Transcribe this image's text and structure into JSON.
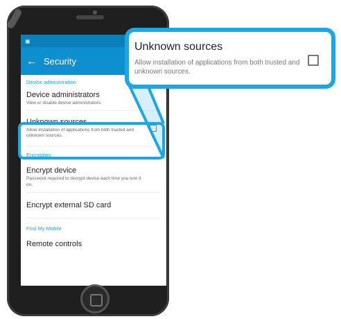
{
  "status_bar": {
    "left": "▣",
    "right": "▾ ▴ ◼"
  },
  "app_bar": {
    "back_icon": "←",
    "title": "Security"
  },
  "sections": {
    "device_admin": "Device administration",
    "encryption": "Encryption",
    "find_mobile": "Find My Mobile"
  },
  "items": {
    "device_admins": {
      "title": "Device administrators",
      "subtitle": "View or disable device administrators."
    },
    "unknown_sources": {
      "title": "Unknown sources",
      "subtitle": "Allow installation of applications from both trusted and unknown sources."
    },
    "encrypt_device": {
      "title": "Encrypt device",
      "subtitle": "Password required to decrypt device each time you turn it on."
    },
    "encrypt_sd": {
      "title": "Encrypt external SD card"
    },
    "remote_controls": {
      "title": "Remote controls"
    }
  },
  "callout": {
    "title": "Unknown sources",
    "subtitle": "Allow installation of applications from both trusted and unknown sources."
  },
  "colors": {
    "accent": "#1aa7e5",
    "app_bar": "#0e8fcf",
    "status_bar": "#0a7fb8"
  }
}
